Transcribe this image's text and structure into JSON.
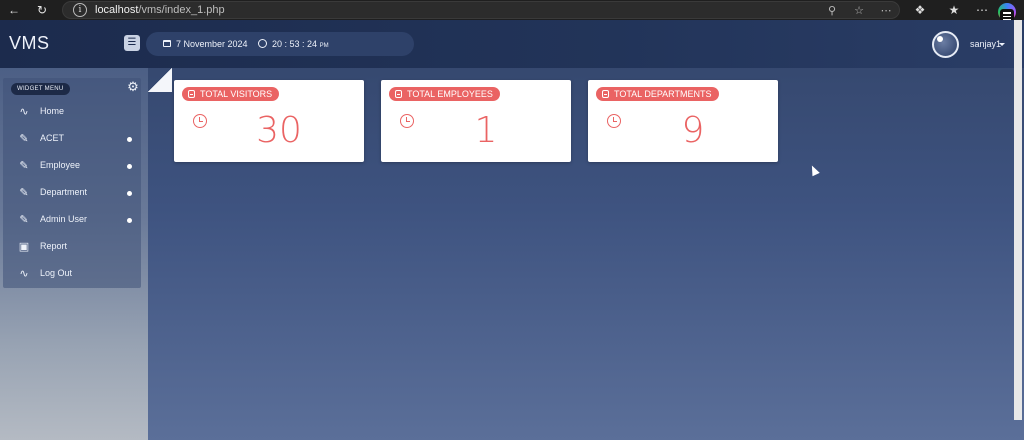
{
  "browser": {
    "url_host": "localhost",
    "url_path": "/vms/index_1.php"
  },
  "header": {
    "brand": "VMS",
    "date": "7 November 2024",
    "time": "20 : 53 : 24",
    "ampm": "PM",
    "username": "sanjay1"
  },
  "sidebar": {
    "widget_menu_label": "WIDGET MENU",
    "items": [
      {
        "label": "Home",
        "icon": "rss-icon",
        "has_submenu": false
      },
      {
        "label": "ACET",
        "icon": "edit-icon",
        "has_submenu": true
      },
      {
        "label": "Employee",
        "icon": "edit-icon",
        "has_submenu": true
      },
      {
        "label": "Department",
        "icon": "edit-icon",
        "has_submenu": true
      },
      {
        "label": "Admin User",
        "icon": "edit-icon",
        "has_submenu": true
      },
      {
        "label": "Report",
        "icon": "camera-icon",
        "has_submenu": false
      },
      {
        "label": "Log Out",
        "icon": "rss-icon",
        "has_submenu": false
      }
    ]
  },
  "cards": [
    {
      "label": "TOTAL VISITORS",
      "value": "30"
    },
    {
      "label": "TOTAL EMPLOYEES",
      "value": "1"
    },
    {
      "label": "TOTAL DEPARTMENTS",
      "value": "9"
    }
  ],
  "colors": {
    "accent": "#ea6363",
    "header": "#1c2b4d"
  }
}
